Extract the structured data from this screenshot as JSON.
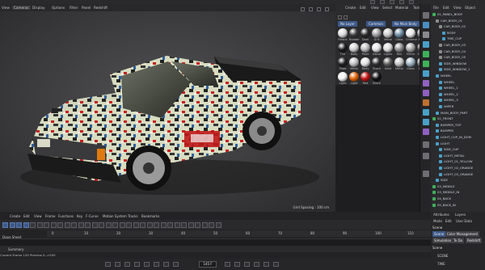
{
  "viewport": {
    "menu": [
      "View",
      "Cameras",
      "Display",
      "Options",
      "Filter",
      "Panel",
      "Redshift"
    ],
    "active_menu_index": 1,
    "title": "Perspective",
    "grid_spacing": "Grid Spacing : 100 cm"
  },
  "materials": {
    "menu": [
      "Create",
      "Edit",
      "View",
      "Select",
      "Material",
      "Texture"
    ],
    "layers": [
      "No Layer",
      "Common",
      "No Main Body"
    ],
    "swatches": [
      {
        "label": "Plastic",
        "color": "#d9d9d9"
      },
      {
        "label": "Rubber",
        "color": "#3a3a3a"
      },
      {
        "label": "Dark",
        "color": "#2a2a2a"
      },
      {
        "label": "Grill",
        "color": "#9a9a9a"
      },
      {
        "label": "Metal",
        "color": "#c9c9c9"
      },
      {
        "label": "Glass",
        "color": "#6a8aa0"
      },
      {
        "label": "Chrome",
        "color": "#e8e8e8"
      },
      {
        "label": "Bolts",
        "color": "#7a7a7a"
      },
      {
        "label": "Tire",
        "color": "#1a1a1a"
      },
      {
        "label": "Body",
        "color": "#cfcfcf"
      },
      {
        "label": "Paint",
        "color": "#b8b8b8"
      },
      {
        "label": "Decal",
        "color": "#e0e0e0"
      },
      {
        "label": "Lights",
        "color": "#d8d8d8"
      },
      {
        "label": "Rim",
        "color": "#8a8a8a"
      },
      {
        "label": "Mirror",
        "color": "#a0a0a0"
      },
      {
        "label": "Shade",
        "color": "#444444"
      },
      {
        "label": "Plate",
        "color": "#1e1e1e"
      },
      {
        "label": "Metal",
        "color": "#bdbdbd"
      },
      {
        "label": "Body",
        "color": "#e0e0e0"
      },
      {
        "label": "Stock",
        "color": "#2d2d2d"
      },
      {
        "label": "Solid",
        "color": "#5a5a5a"
      },
      {
        "label": "Metal",
        "color": "#c0c0c0"
      },
      {
        "label": "Glass",
        "color": "#9ab0c0"
      },
      {
        "label": "Bolts",
        "color": "#777777"
      },
      {
        "label": "Light",
        "color": "#f0f0f0"
      },
      {
        "label": "Light",
        "color": "#e06000"
      },
      {
        "label": "Red",
        "color": "#c01010"
      },
      {
        "label": "Black",
        "color": "#101010"
      }
    ]
  },
  "objects": {
    "menu": [
      "File",
      "Edit",
      "View",
      "Object"
    ],
    "tree": [
      "01_PANEL_BODY",
      "CAR_BODY_01",
      "CAR_BODY_02",
      "BODY",
      "TIRE_CUP",
      "CAR_BODY_03",
      "CAR_BODY_04",
      "CAR_BODY_05",
      "SIDE_WINDOW",
      "SIDE_WINDOW_1",
      "WHEEL",
      "WHEEL",
      "WHEEL_1",
      "WHEEL_2",
      "WHEEL_3",
      "WIPER",
      "MAIN_BODY_PART",
      "02_FRONT",
      "BUMPER_TOP",
      "BUMPER",
      "LIGHT_CUP_IN_DOM",
      "LIGHT",
      "SIDE_CUP",
      "LIGHT_METAL",
      "LIGHT_01_YELLOW",
      "LIGHT_02_ORANGE",
      "LIGHT_03_ORANGE",
      "SIDE",
      "03_MIDDLE",
      "03_MIDDLE_IN",
      "04_BACK",
      "05_BACK_IN"
    ]
  },
  "attributes": {
    "tabs": [
      "Attributes",
      "Layers"
    ],
    "menu": [
      "Mode",
      "Edit",
      "User Data"
    ],
    "selected": "Scene",
    "sub_tabs": [
      "Scene",
      "Color Management"
    ],
    "sub_tabs2": [
      "Simulation",
      "To Do",
      "Redshift"
    ],
    "section": "Scene",
    "rows": [
      "SCENE",
      "TIME"
    ]
  },
  "timeline": {
    "menu": [
      "Create",
      "Edit",
      "View",
      "Frame",
      "Functions",
      "Key",
      "F-Curve",
      "Motion System",
      "Tracks",
      "Bookmarks"
    ],
    "ruler_start": "0",
    "ruler_ticks": [
      "0",
      "10",
      "20",
      "30",
      "40",
      "50",
      "60",
      "70",
      "80",
      "90",
      "100",
      "110"
    ],
    "track_label": "Dope Sheet",
    "summary": "Summary",
    "status": "Current Frame 145 Preview 0-->500",
    "frame": "145 F"
  },
  "colors": {
    "accent": "#3d5a8a",
    "bg": "#1e1e20"
  }
}
